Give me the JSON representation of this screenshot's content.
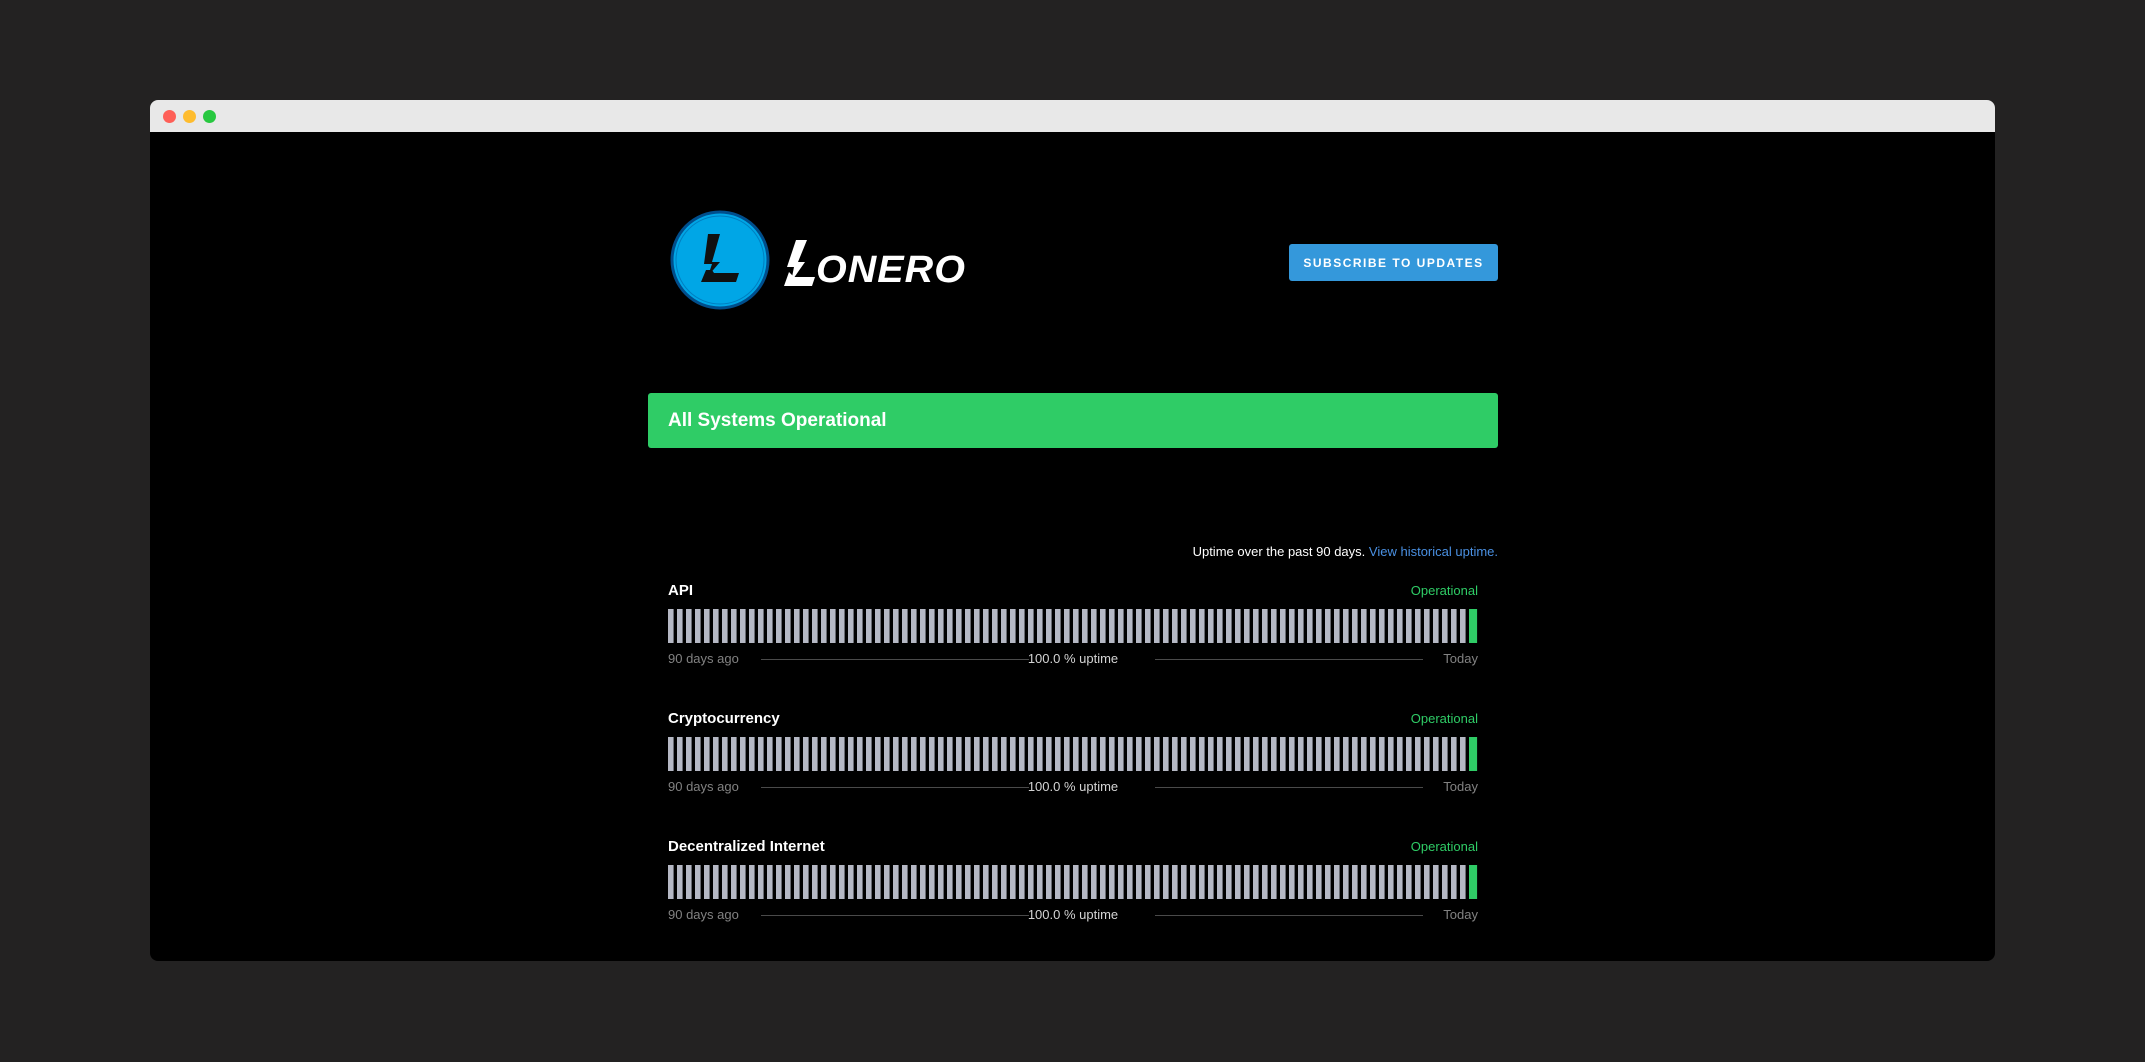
{
  "window": {
    "controls": [
      "close",
      "minimize",
      "maximize"
    ]
  },
  "header": {
    "logo_text": "LONERO",
    "subscribe_label": "SUBSCRIBE TO UPDATES"
  },
  "status_banner": {
    "text": "All Systems Operational",
    "color": "#2fcc66"
  },
  "uptime_note": {
    "text": "Uptime over the past 90 days.",
    "link": "View historical uptime."
  },
  "colors": {
    "bar_operational_past": "#b5b8c4",
    "bar_operational_today": "#2fcc66",
    "accent": "#3498db",
    "link": "#4a90e2"
  },
  "components": [
    {
      "name": "API",
      "status": "Operational",
      "days": 90,
      "uptime_label": "100.0 % uptime",
      "start_label": "90 days ago",
      "end_label": "Today"
    },
    {
      "name": "Cryptocurrency",
      "status": "Operational",
      "days": 90,
      "uptime_label": "100.0 % uptime",
      "start_label": "90 days ago",
      "end_label": "Today"
    },
    {
      "name": "Decentralized Internet",
      "status": "Operational",
      "days": 90,
      "uptime_label": "100.0 % uptime",
      "start_label": "90 days ago",
      "end_label": "Today"
    }
  ]
}
